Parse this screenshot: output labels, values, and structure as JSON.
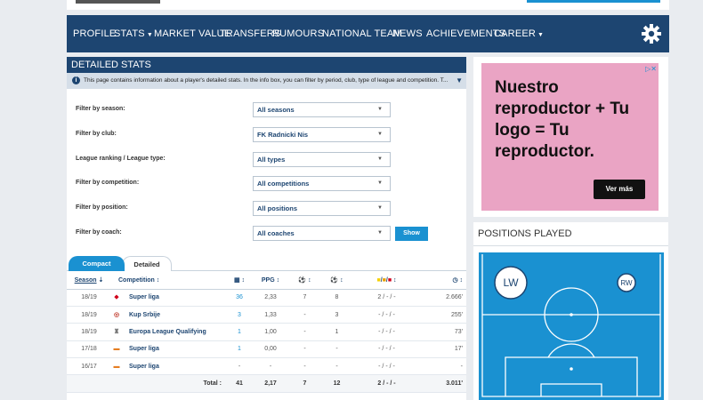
{
  "nav": {
    "items": [
      "PROFILE",
      "STATS",
      "MARKET VALUE",
      "TRANSFERS",
      "RUMOURS",
      "NATIONAL TEAM",
      "NEWS",
      "ACHIEVEMENTS",
      "CAREER"
    ],
    "dropdown_items": [
      "STATS",
      "CAREER"
    ],
    "settings_icon": "gear-icon"
  },
  "panel": {
    "title": "DETAILED STATS",
    "info": "This page contains information about a player's detailed stats. In the info box, you can filter by period, club, type of league and competition. T...",
    "info_icon": "info-icon"
  },
  "filters": [
    {
      "label": "Filter by season:",
      "value": "All seasons"
    },
    {
      "label": "Filter by club:",
      "value": "FK Radnicki Nis"
    },
    {
      "label": "League ranking / League type:",
      "value": "All types"
    },
    {
      "label": "Filter by competition:",
      "value": "All competitions"
    },
    {
      "label": "Filter by position:",
      "value": "All positions"
    },
    {
      "label": "Filter by coach:",
      "value": "All coaches"
    }
  ],
  "show_button": "Show",
  "tabs": {
    "compact": "Compact",
    "detailed": "Detailed"
  },
  "table": {
    "headers": {
      "season": "Season",
      "competition": "Competition",
      "ppg": "PPG"
    },
    "rows": [
      {
        "season": "18/19",
        "icon": "superliga-logo-icon",
        "competition": "Super liga",
        "apps": "36",
        "ppg": "2,33",
        "goals": "7",
        "assists": "8",
        "cards": "2 / - / -",
        "minutes": "2.666'"
      },
      {
        "season": "18/19",
        "icon": "cup-logo-icon",
        "competition": "Kup Srbije",
        "apps": "3",
        "ppg": "1,33",
        "goals": "-",
        "assists": "3",
        "cards": "- / - / -",
        "minutes": "255'"
      },
      {
        "season": "18/19",
        "icon": "trophy-icon",
        "competition": "Europa League Qualifying",
        "apps": "1",
        "ppg": "1,00",
        "goals": "-",
        "assists": "1",
        "cards": "- / - / -",
        "minutes": "73'"
      },
      {
        "season": "17/18",
        "icon": "superliga-logo-icon",
        "competition": "Super liga",
        "apps": "1",
        "ppg": "0,00",
        "goals": "-",
        "assists": "-",
        "cards": "- / - / -",
        "minutes": "17'"
      },
      {
        "season": "16/17",
        "icon": "superliga-logo-icon",
        "competition": "Super liga",
        "apps": "-",
        "ppg": "-",
        "goals": "-",
        "assists": "-",
        "cards": "- / - / -",
        "minutes": "-"
      }
    ],
    "total": {
      "label": "Total :",
      "apps": "41",
      "ppg": "2,17",
      "goals": "7",
      "assists": "12",
      "cards": "2 / - / -",
      "minutes": "3.011'"
    }
  },
  "ad": {
    "text": "Nuestro reproductor + Tu logo = Tu reproductor.",
    "button": "Ver más",
    "close": "▷✕"
  },
  "positions": {
    "title": "POSITIONS PLAYED",
    "markers": [
      "LW",
      "RW"
    ]
  },
  "colors": {
    "navy": "#1d4571",
    "accent": "#1a91d1",
    "pitch": "#1a91d1",
    "ad_bg": "#eaa4c4"
  }
}
